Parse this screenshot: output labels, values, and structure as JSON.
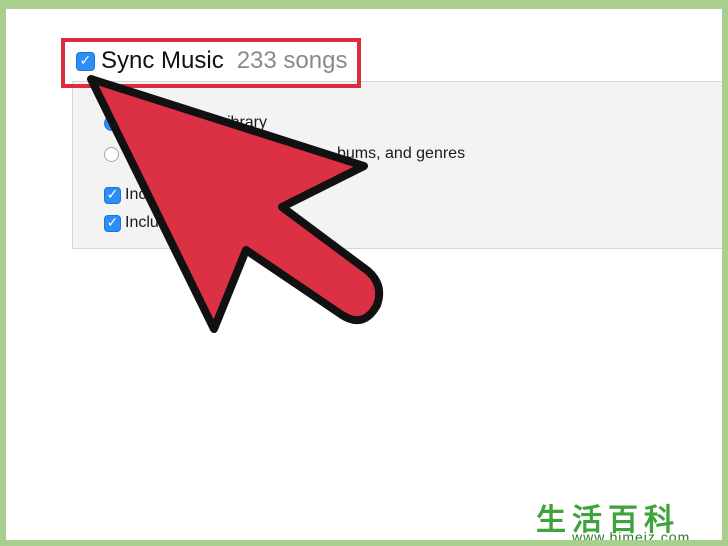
{
  "sync": {
    "label": "Sync Music",
    "song_count": "233 songs",
    "checked": true
  },
  "options": {
    "radio_entire": {
      "visible_text": "ibrary",
      "selected": true
    },
    "radio_selected": {
      "visible_text": "bums, and genres",
      "selected": false
    },
    "include_1": {
      "visible_text": "Inc",
      "checked": true
    },
    "include_2": {
      "visible_text": "Inclu",
      "checked": true
    }
  },
  "overlay": {
    "arrow_color": "#dc3044",
    "highlight_color": "#dc2d3f"
  },
  "watermark": {
    "chinese": "生活百科",
    "url": "www.bimeiz.com"
  },
  "colors": {
    "frame_border": "#a8cf8e",
    "checkbox_blue": "#2d8ff5",
    "panel_bg": "#f3f3f3"
  }
}
